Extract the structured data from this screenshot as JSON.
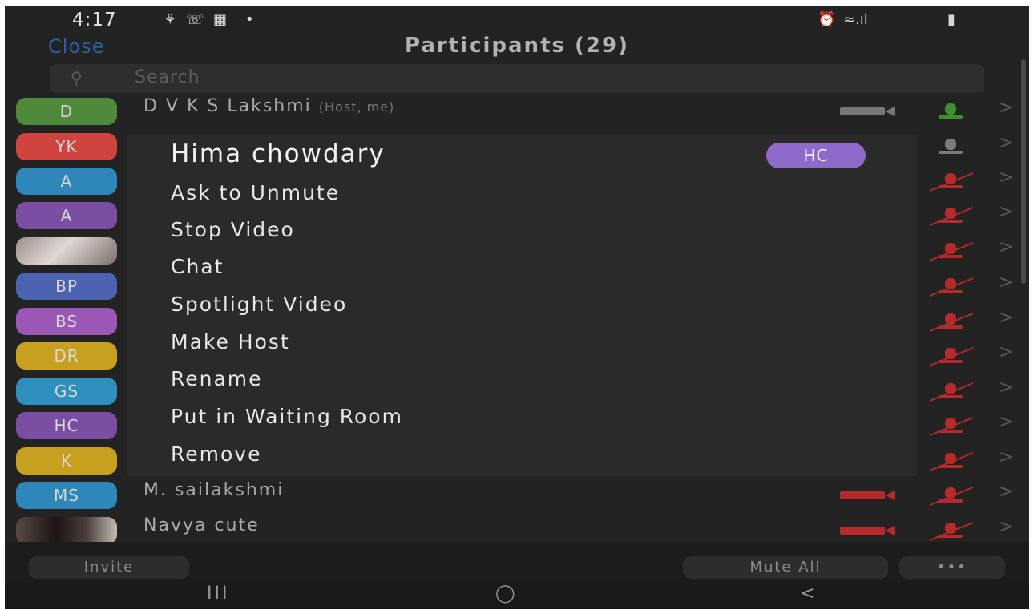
{
  "status": {
    "time": "4:17",
    "left_icons": [
      "notification-icon",
      "whatsapp-icon",
      "gallery-icon",
      "dot-icon"
    ],
    "right_icons": [
      "alarm-icon",
      "wifi-signal-icon",
      "battery-icon"
    ]
  },
  "header": {
    "close_label": "Close",
    "title": "Participants (29)"
  },
  "search": {
    "placeholder": "Search"
  },
  "participants": [
    {
      "initials": "D",
      "name": "D V K S Lakshmi",
      "tag": "(Host, me)",
      "color": "#4f8a3c",
      "mic": "on",
      "video": "on"
    },
    {
      "initials": "YK",
      "name": "",
      "color": "#d0443f",
      "mic": "idle"
    },
    {
      "initials": "A",
      "name": "",
      "color": "#2f86b9",
      "mic": "muted"
    },
    {
      "initials": "A",
      "name": "",
      "color": "#7a4fa3",
      "mic": "muted"
    },
    {
      "initials": "",
      "name": "",
      "photo": true,
      "mic": "muted"
    },
    {
      "initials": "BP",
      "name": "",
      "color": "#4b63b0",
      "mic": "muted"
    },
    {
      "initials": "BS",
      "name": "",
      "color": "#9b57b5",
      "mic": "muted"
    },
    {
      "initials": "DR",
      "name": "",
      "color": "#c8a020",
      "mic": "muted"
    },
    {
      "initials": "GS",
      "name": "",
      "color": "#2f8fbf",
      "mic": "muted"
    },
    {
      "initials": "HC",
      "name": "",
      "color": "#7a4fa3",
      "mic": "muted"
    },
    {
      "initials": "K",
      "name": "",
      "color": "#c8a020",
      "mic": "muted"
    },
    {
      "initials": "MS",
      "name": "M. sailakshmi",
      "color": "#2f86b9",
      "mic": "muted",
      "video": "off"
    },
    {
      "initials": "",
      "name": "Navya cute",
      "photo": true,
      "mic": "muted",
      "video": "off"
    }
  ],
  "menu": {
    "name": "Hima chowdary",
    "badge": "HC",
    "badge_color": "#8e6acb",
    "items": [
      "Ask to Unmute",
      "Stop Video",
      "Chat",
      "Spotlight Video",
      "Make Host",
      "Rename",
      "Put in Waiting Room",
      "Remove"
    ]
  },
  "bottom": {
    "invite": "Invite",
    "mute_all": "Mute All",
    "more": "•••"
  },
  "nav": {
    "recents": "III",
    "home": "◯",
    "back": "<"
  },
  "colors": {
    "muted": "#b52a2a",
    "active": "#3f8f2f"
  }
}
